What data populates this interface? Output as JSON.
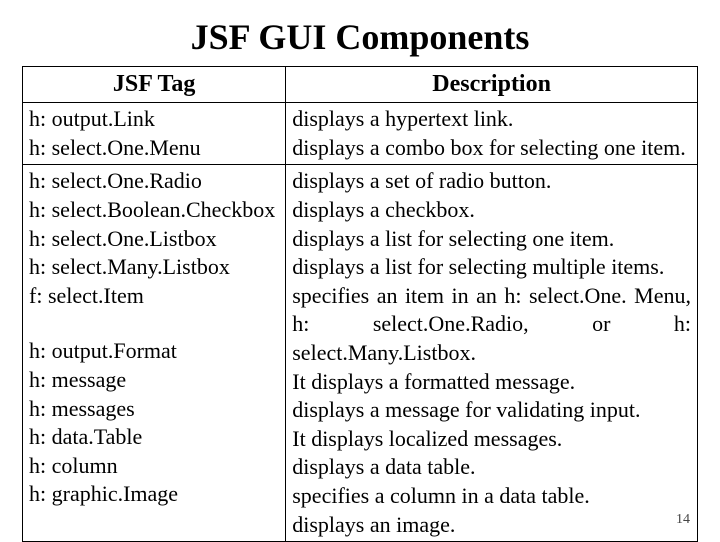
{
  "title": "JSF GUI Components",
  "headers": {
    "tag": "JSF Tag",
    "desc": "Description"
  },
  "group1": [
    {
      "tag": "h: output.Link",
      "desc": "displays a hypertext link."
    },
    {
      "tag": "h: select.One.Menu",
      "desc": "displays a combo box for selecting one item."
    }
  ],
  "group2": [
    {
      "tag": "h: select.One.Radio",
      "desc": "displays a set of radio button."
    },
    {
      "tag": "h: select.Boolean.Checkbox",
      "desc": "displays a checkbox."
    },
    {
      "tag": "h: select.One.Listbox",
      "desc": "displays a list for selecting one item."
    },
    {
      "tag": "h: select.Many.Listbox",
      "desc": "displays a list for selecting multiple items."
    },
    {
      "tag": "f: select.Item",
      "desc": "specifies an item in an h: select.One. Menu, h: select.One.Radio, or h: select.Many.Listbox."
    },
    {
      "tag": "h: output.Format",
      "desc": "It displays a formatted message."
    },
    {
      "tag": "h: message",
      "desc": "displays a message for validating input."
    },
    {
      "tag": "h: messages",
      "desc": "It displays localized messages."
    },
    {
      "tag": "h: data.Table",
      "desc": "displays a data table."
    },
    {
      "tag": "h: column",
      "desc": "specifies a column in a data table."
    },
    {
      "tag": "h: graphic.Image",
      "desc": "displays an image."
    }
  ],
  "page_number": "14"
}
